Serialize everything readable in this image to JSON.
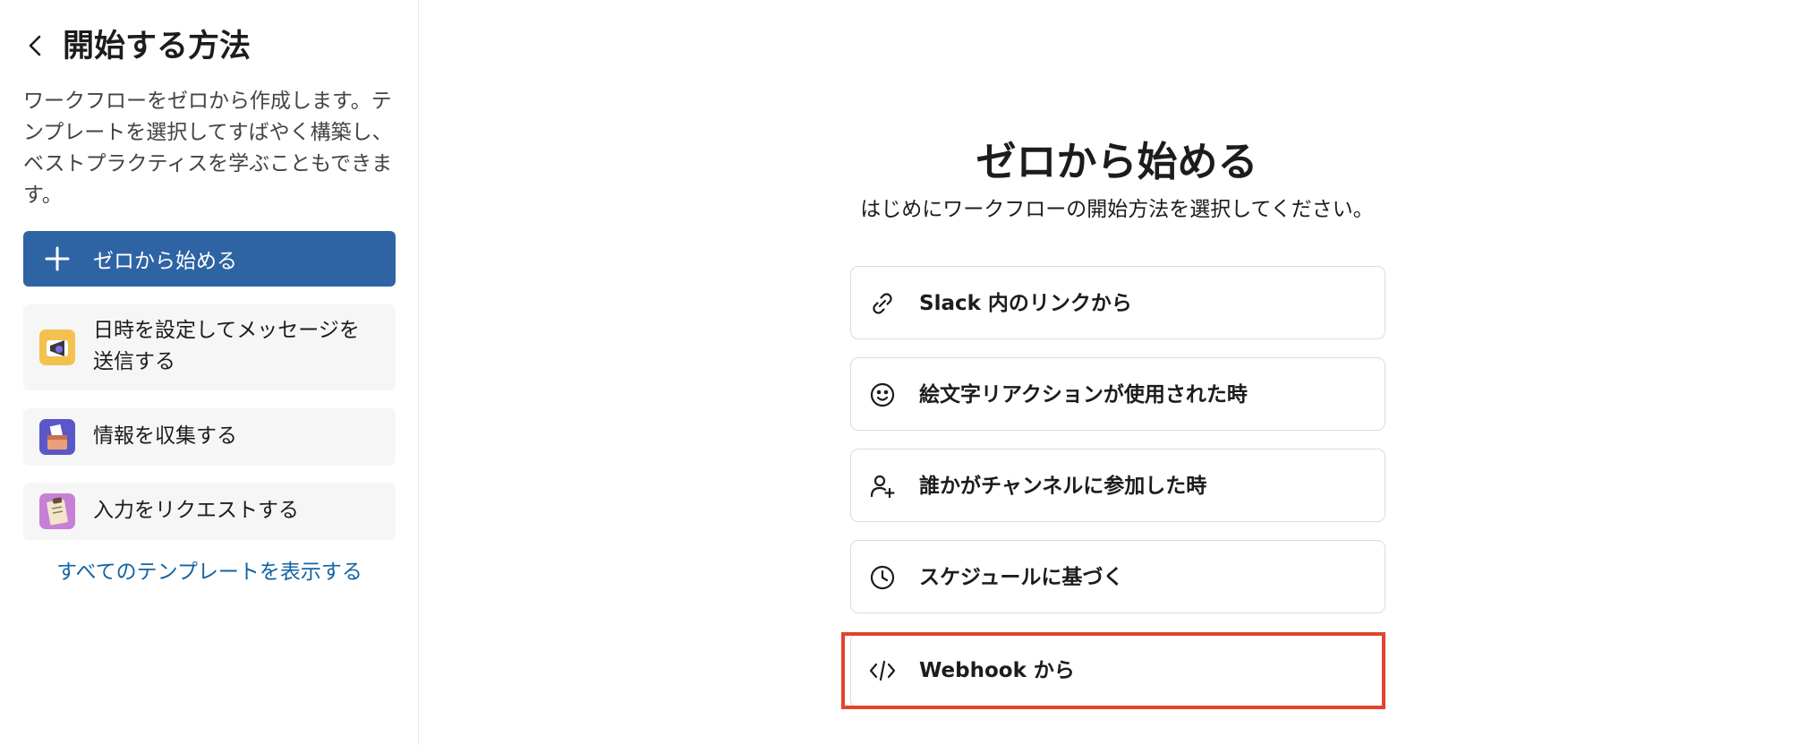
{
  "sidebar": {
    "title": "開始する方法",
    "description": "ワークフローをゼロから作成します。テンプレートを選択してすばやく構築し、ベストプラクティスを学ぶこともできます。",
    "primary_button_label": "ゼロから始める",
    "templates": [
      {
        "label": "日時を設定してメッセージを送信する",
        "icon": "calendar-megaphone-icon"
      },
      {
        "label": "情報を収集する",
        "icon": "ballot-box-icon"
      },
      {
        "label": "入力をリクエストする",
        "icon": "clipboard-icon"
      }
    ],
    "all_templates_link": "すべてのテンプレートを表示する"
  },
  "main": {
    "title": "ゼロから始める",
    "subtitle": "はじめにワークフローの開始方法を選択してください。",
    "options": [
      {
        "label": "Slack 内のリンクから",
        "icon": "link-icon"
      },
      {
        "label": "絵文字リアクションが使用された時",
        "icon": "smiley-icon"
      },
      {
        "label": "誰かがチャンネルに参加した時",
        "icon": "user-add-icon"
      },
      {
        "label": "スケジュールに基づく",
        "icon": "clock-icon"
      },
      {
        "label": "Webhook から",
        "icon": "code-icon"
      }
    ]
  },
  "colors": {
    "primary_button": "#2e64a4",
    "link": "#1264a3",
    "highlight_border": "#e0452e"
  }
}
